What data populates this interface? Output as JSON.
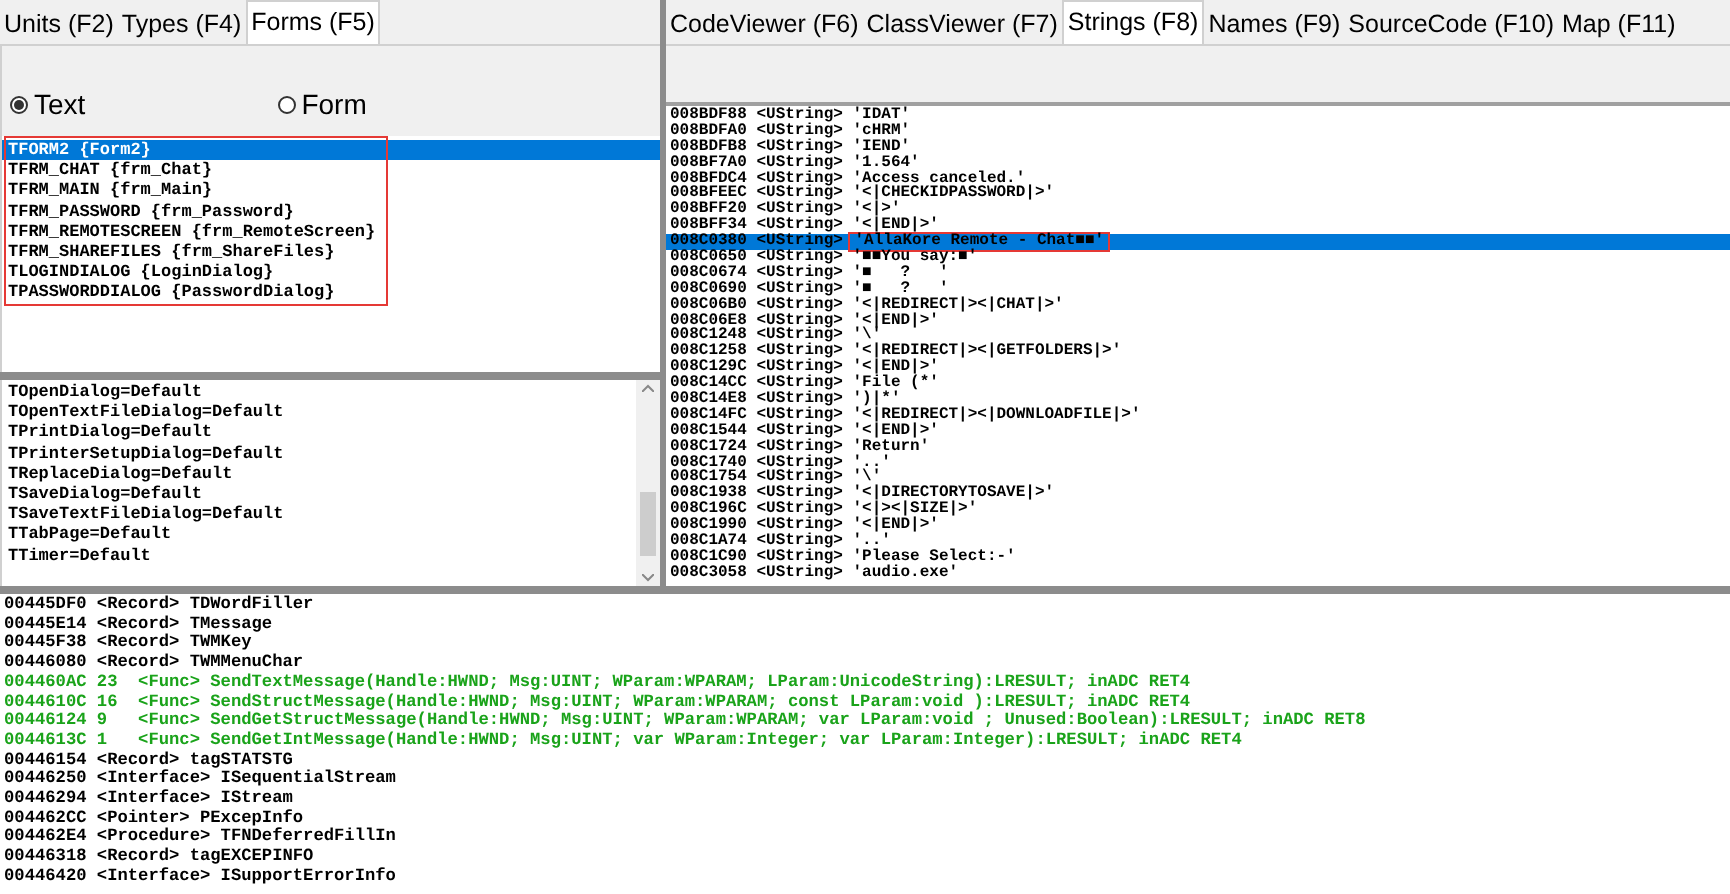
{
  "left_tabs": [
    {
      "label": "Units (F2)",
      "selected": false
    },
    {
      "label": "Types (F4)",
      "selected": false
    },
    {
      "label": "Forms (F5)",
      "selected": true
    }
  ],
  "view_mode": [
    {
      "label": "Text",
      "selected": true
    },
    {
      "label": "Form",
      "selected": false
    }
  ],
  "forms_list": {
    "boxed": true,
    "items": [
      {
        "text": "TFORM2 {Form2}",
        "selected": true
      },
      {
        "text": "TFRM_CHAT {frm_Chat}",
        "selected": false
      },
      {
        "text": "TFRM_MAIN {frm_Main}",
        "selected": false
      },
      {
        "text": "TFRM_PASSWORD {frm_Password}",
        "selected": false
      },
      {
        "text": "TFRM_REMOTESCREEN {frm_RemoteScreen}",
        "selected": false
      },
      {
        "text": "TFRM_SHAREFILES {frm_ShareFiles}",
        "selected": false
      },
      {
        "text": "TLOGINDIALOG {LoginDialog}",
        "selected": false
      },
      {
        "text": "TPASSWORDDIALOG {PasswordDialog}",
        "selected": false
      }
    ]
  },
  "defaults_list": [
    "TOpenDialog=Default",
    "TOpenTextFileDialog=Default",
    "TPrintDialog=Default",
    "TPrinterSetupDialog=Default",
    "TReplaceDialog=Default",
    "TSaveDialog=Default",
    "TSaveTextFileDialog=Default",
    "TTabPage=Default",
    "TTimer=Default"
  ],
  "right_tabs": [
    {
      "label": "CodeViewer (F6)",
      "selected": false
    },
    {
      "label": "ClassViewer (F7)",
      "selected": false
    },
    {
      "label": "Strings (F8)",
      "selected": true
    },
    {
      "label": "Names (F9)",
      "selected": false
    },
    {
      "label": "SourceCode (F10)",
      "selected": false
    },
    {
      "label": "Map (F11)",
      "selected": false
    }
  ],
  "strings": [
    {
      "address": "008BDF88",
      "type": "<UString>",
      "value": "'IDAT'",
      "selected": false,
      "boxed": false
    },
    {
      "address": "008BDFA0",
      "type": "<UString>",
      "value": "'cHRM'",
      "selected": false,
      "boxed": false
    },
    {
      "address": "008BDFB8",
      "type": "<UString>",
      "value": "'IEND'",
      "selected": false,
      "boxed": false
    },
    {
      "address": "008BF7A0",
      "type": "<UString>",
      "value": "'1.564'",
      "selected": false,
      "boxed": false
    },
    {
      "address": "008BFDC4",
      "type": "<UString>",
      "value": "'Access canceled.'",
      "selected": false,
      "boxed": false
    },
    {
      "address": "008BFEEC",
      "type": "<UString>",
      "value": "'<|CHECKIDPASSWORD|>'",
      "selected": false,
      "boxed": false
    },
    {
      "address": "008BFF20",
      "type": "<UString>",
      "value": "'<|>'",
      "selected": false,
      "boxed": false
    },
    {
      "address": "008BFF34",
      "type": "<UString>",
      "value": "'<|END|>'",
      "selected": false,
      "boxed": false
    },
    {
      "address": "008C0380",
      "type": "<UString>",
      "value": "'AllaKore Remote - Chat■■'",
      "selected": true,
      "boxed": true
    },
    {
      "address": "008C0650",
      "type": "<UString>",
      "value": "'■■You say:■'",
      "selected": false,
      "boxed": false
    },
    {
      "address": "008C0674",
      "type": "<UString>",
      "value": "'■   ?   '",
      "selected": false,
      "boxed": false
    },
    {
      "address": "008C0690",
      "type": "<UString>",
      "value": "'■   ?   '",
      "selected": false,
      "boxed": false
    },
    {
      "address": "008C06B0",
      "type": "<UString>",
      "value": "'<|REDIRECT|><|CHAT|>'",
      "selected": false,
      "boxed": false
    },
    {
      "address": "008C06E8",
      "type": "<UString>",
      "value": "'<|END|>'",
      "selected": false,
      "boxed": false
    },
    {
      "address": "008C1248",
      "type": "<UString>",
      "value": "'\\'",
      "selected": false,
      "boxed": false
    },
    {
      "address": "008C1258",
      "type": "<UString>",
      "value": "'<|REDIRECT|><|GETFOLDERS|>'",
      "selected": false,
      "boxed": false
    },
    {
      "address": "008C129C",
      "type": "<UString>",
      "value": "'<|END|>'",
      "selected": false,
      "boxed": false
    },
    {
      "address": "008C14CC",
      "type": "<UString>",
      "value": "'File (*'",
      "selected": false,
      "boxed": false
    },
    {
      "address": "008C14E8",
      "type": "<UString>",
      "value": "')|*'",
      "selected": false,
      "boxed": false
    },
    {
      "address": "008C14FC",
      "type": "<UString>",
      "value": "'<|REDIRECT|><|DOWNLOADFILE|>'",
      "selected": false,
      "boxed": false
    },
    {
      "address": "008C1544",
      "type": "<UString>",
      "value": "'<|END|>'",
      "selected": false,
      "boxed": false
    },
    {
      "address": "008C1724",
      "type": "<UString>",
      "value": "'Return'",
      "selected": false,
      "boxed": false
    },
    {
      "address": "008C1740",
      "type": "<UString>",
      "value": "'..'",
      "selected": false,
      "boxed": false
    },
    {
      "address": "008C1754",
      "type": "<UString>",
      "value": "'\\'",
      "selected": false,
      "boxed": false
    },
    {
      "address": "008C1938",
      "type": "<UString>",
      "value": "'<|DIRECTORYTOSAVE|>'",
      "selected": false,
      "boxed": false
    },
    {
      "address": "008C196C",
      "type": "<UString>",
      "value": "'<|><|SIZE|>'",
      "selected": false,
      "boxed": false
    },
    {
      "address": "008C1990",
      "type": "<UString>",
      "value": "'<|END|>'",
      "selected": false,
      "boxed": false
    },
    {
      "address": "008C1A74",
      "type": "<UString>",
      "value": "'..'",
      "selected": false,
      "boxed": false
    },
    {
      "address": "008C1C90",
      "type": "<UString>",
      "value": "'Please Select:-'",
      "selected": false,
      "boxed": false
    },
    {
      "address": "008C3058",
      "type": "<UString>",
      "value": "'audio.exe'",
      "selected": false,
      "boxed": false
    }
  ],
  "code_listing": [
    {
      "kind": "record",
      "text": "00445DF0 <Record> TDWordFiller"
    },
    {
      "kind": "record",
      "text": "00445E14 <Record> TMessage"
    },
    {
      "kind": "record",
      "text": "00445F38 <Record> TWMKey"
    },
    {
      "kind": "record",
      "text": "00446080 <Record> TWMMenuChar"
    },
    {
      "kind": "func",
      "text": "004460AC 23  <Func> SendTextMessage(Handle:HWND; Msg:UINT; WParam:WPARAM; LParam:UnicodeString):LRESULT; inADC RET4"
    },
    {
      "kind": "func",
      "text": "0044610C 16  <Func> SendStructMessage(Handle:HWND; Msg:UINT; WParam:WPARAM; const LParam:void ):LRESULT; inADC RET4"
    },
    {
      "kind": "func",
      "text": "00446124 9   <Func> SendGetStructMessage(Handle:HWND; Msg:UINT; WParam:WPARAM; var LParam:void ; Unused:Boolean):LRESULT; inADC RET8"
    },
    {
      "kind": "func",
      "text": "0044613C 1   <Func> SendGetIntMessage(Handle:HWND; Msg:UINT; var WParam:Integer; var LParam:Integer):LRESULT; inADC RET4"
    },
    {
      "kind": "record",
      "text": "00446154 <Record> tagSTATSTG"
    },
    {
      "kind": "record",
      "text": "00446250 <Interface> ISequentialStream"
    },
    {
      "kind": "record",
      "text": "00446294 <Interface> IStream"
    },
    {
      "kind": "record",
      "text": "004462CC <Pointer> PExcepInfo"
    },
    {
      "kind": "record",
      "text": "004462E4 <Procedure> TFNDeferredFillIn"
    },
    {
      "kind": "record",
      "text": "00446318 <Record> tagEXCEPINFO"
    },
    {
      "kind": "record",
      "text": "00446420 <Interface> ISupportErrorInfo"
    }
  ]
}
